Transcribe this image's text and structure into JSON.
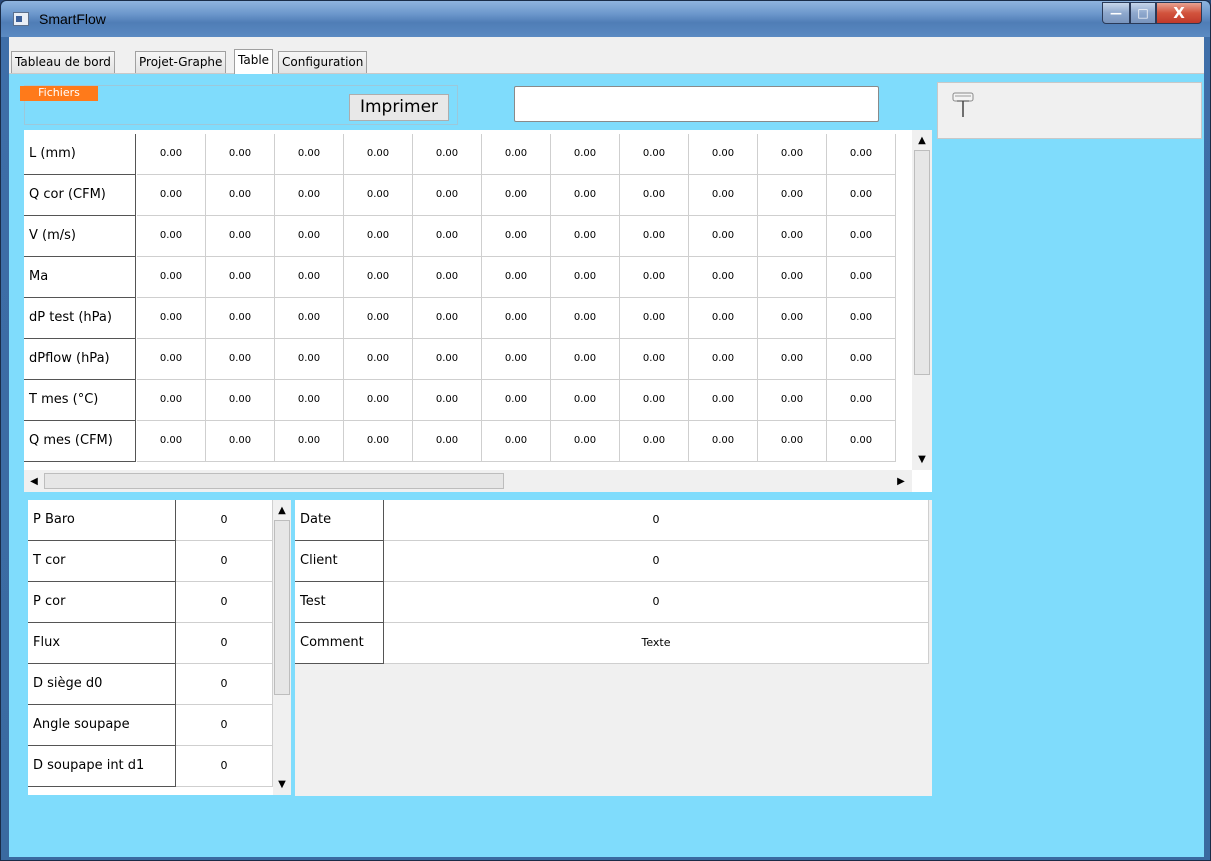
{
  "window": {
    "title": "SmartFlow",
    "controls": {
      "minimize": "—",
      "maximize": "□",
      "close": "X"
    }
  },
  "tabs": [
    {
      "label": "Tableau de bord",
      "active": false
    },
    {
      "label": "Projet-Graphe",
      "active": false
    },
    {
      "label": "Table",
      "active": true
    },
    {
      "label": "Configuration",
      "active": false
    }
  ],
  "toolbar": {
    "fichiers_label": "Fichiers",
    "print_label": "Imprimer",
    "search_value": ""
  },
  "grid": {
    "rows": [
      {
        "label": "L (mm)",
        "values": [
          "0.00",
          "0.00",
          "0.00",
          "0.00",
          "0.00",
          "0.00",
          "0.00",
          "0.00",
          "0.00",
          "0.00",
          "0.00"
        ]
      },
      {
        "label": "Q cor (CFM)",
        "values": [
          "0.00",
          "0.00",
          "0.00",
          "0.00",
          "0.00",
          "0.00",
          "0.00",
          "0.00",
          "0.00",
          "0.00",
          "0.00"
        ]
      },
      {
        "label": "V (m/s)",
        "values": [
          "0.00",
          "0.00",
          "0.00",
          "0.00",
          "0.00",
          "0.00",
          "0.00",
          "0.00",
          "0.00",
          "0.00",
          "0.00"
        ]
      },
      {
        "label": "Ma",
        "values": [
          "0.00",
          "0.00",
          "0.00",
          "0.00",
          "0.00",
          "0.00",
          "0.00",
          "0.00",
          "0.00",
          "0.00",
          "0.00"
        ]
      },
      {
        "label": "dP test (hPa)",
        "values": [
          "0.00",
          "0.00",
          "0.00",
          "0.00",
          "0.00",
          "0.00",
          "0.00",
          "0.00",
          "0.00",
          "0.00",
          "0.00"
        ]
      },
      {
        "label": "dPflow (hPa)",
        "values": [
          "0.00",
          "0.00",
          "0.00",
          "0.00",
          "0.00",
          "0.00",
          "0.00",
          "0.00",
          "0.00",
          "0.00",
          "0.00"
        ]
      },
      {
        "label": "T mes (°C)",
        "values": [
          "0.00",
          "0.00",
          "0.00",
          "0.00",
          "0.00",
          "0.00",
          "0.00",
          "0.00",
          "0.00",
          "0.00",
          "0.00"
        ]
      },
      {
        "label": "Q mes (CFM)",
        "values": [
          "0.00",
          "0.00",
          "0.00",
          "0.00",
          "0.00",
          "0.00",
          "0.00",
          "0.00",
          "0.00",
          "0.00",
          "0.00"
        ]
      }
    ]
  },
  "params": [
    {
      "label": "P Baro",
      "value": "0"
    },
    {
      "label": "T cor",
      "value": "0"
    },
    {
      "label": "P cor",
      "value": "0"
    },
    {
      "label": "Flux",
      "value": "0"
    },
    {
      "label": "D siège d0",
      "value": "0"
    },
    {
      "label": "Angle soupape",
      "value": "0"
    },
    {
      "label": "D soupape int d1",
      "value": "0"
    }
  ],
  "info": [
    {
      "label": "Date",
      "value": "0"
    },
    {
      "label": "Client",
      "value": "0"
    },
    {
      "label": "Test",
      "value": "0"
    },
    {
      "label": "Comment",
      "value": "Texte"
    }
  ],
  "scroll_arrows": {
    "up": "▲",
    "down": "▼",
    "left": "◀",
    "right": "▶"
  },
  "colors": {
    "client_bg": "#7fdcfc",
    "fichiers_bg": "#ff7a1a",
    "close_btn": "#c0392b"
  }
}
